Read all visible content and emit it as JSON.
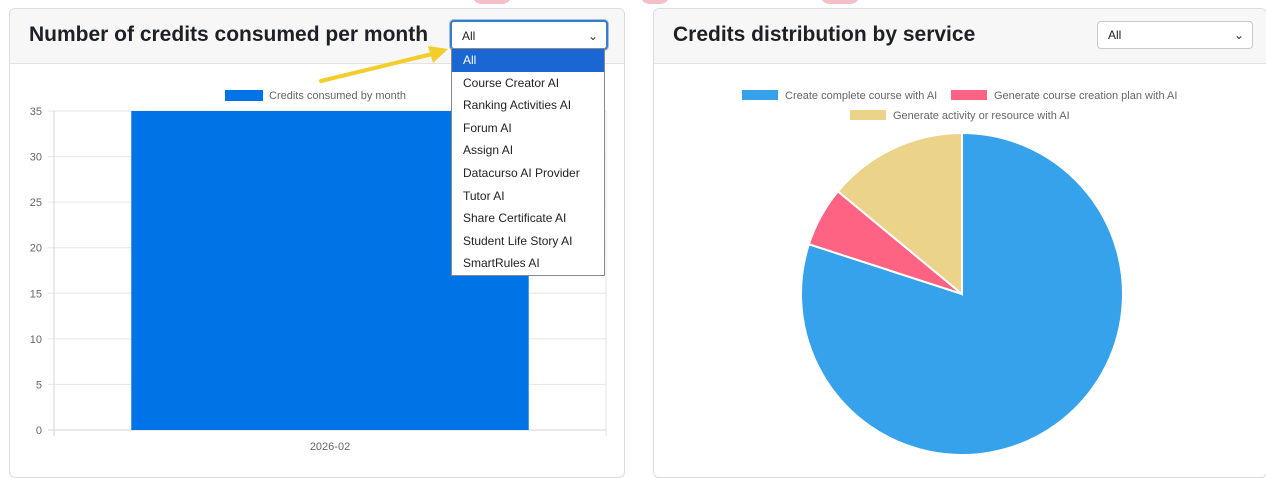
{
  "left_panel": {
    "title": "Number of credits consumed per month",
    "select": {
      "value": "All",
      "options": [
        "All",
        "Course Creator AI",
        "Ranking Activities AI",
        "Forum AI",
        "Assign AI",
        "Datacurso AI Provider",
        "Tutor AI",
        "Share Certificate AI",
        "Student Life Story AI",
        "SmartRules AI"
      ],
      "open": true
    }
  },
  "right_panel": {
    "title": "Credits distribution by service",
    "select": {
      "value": "All"
    }
  },
  "colors": {
    "bar": "#0073e6",
    "pie": [
      "#36a2eb",
      "#ff6384",
      "#ecd38a"
    ],
    "annotation_arrow": "#f2cd2c"
  },
  "chart_data": [
    {
      "type": "bar",
      "categories": [
        "2026-02"
      ],
      "series": [
        {
          "name": "Credits consumed by month",
          "values": [
            35
          ]
        }
      ],
      "ylim": [
        0,
        35
      ],
      "yticks": [
        0,
        5,
        10,
        15,
        20,
        25,
        30,
        35
      ],
      "grid": true,
      "legend": "top"
    },
    {
      "type": "pie",
      "labels": [
        "Create complete course with AI",
        "Generate course creation plan with AI",
        "Generate activity or resource with AI"
      ],
      "values": [
        80,
        6,
        14
      ],
      "legend": "top"
    }
  ]
}
